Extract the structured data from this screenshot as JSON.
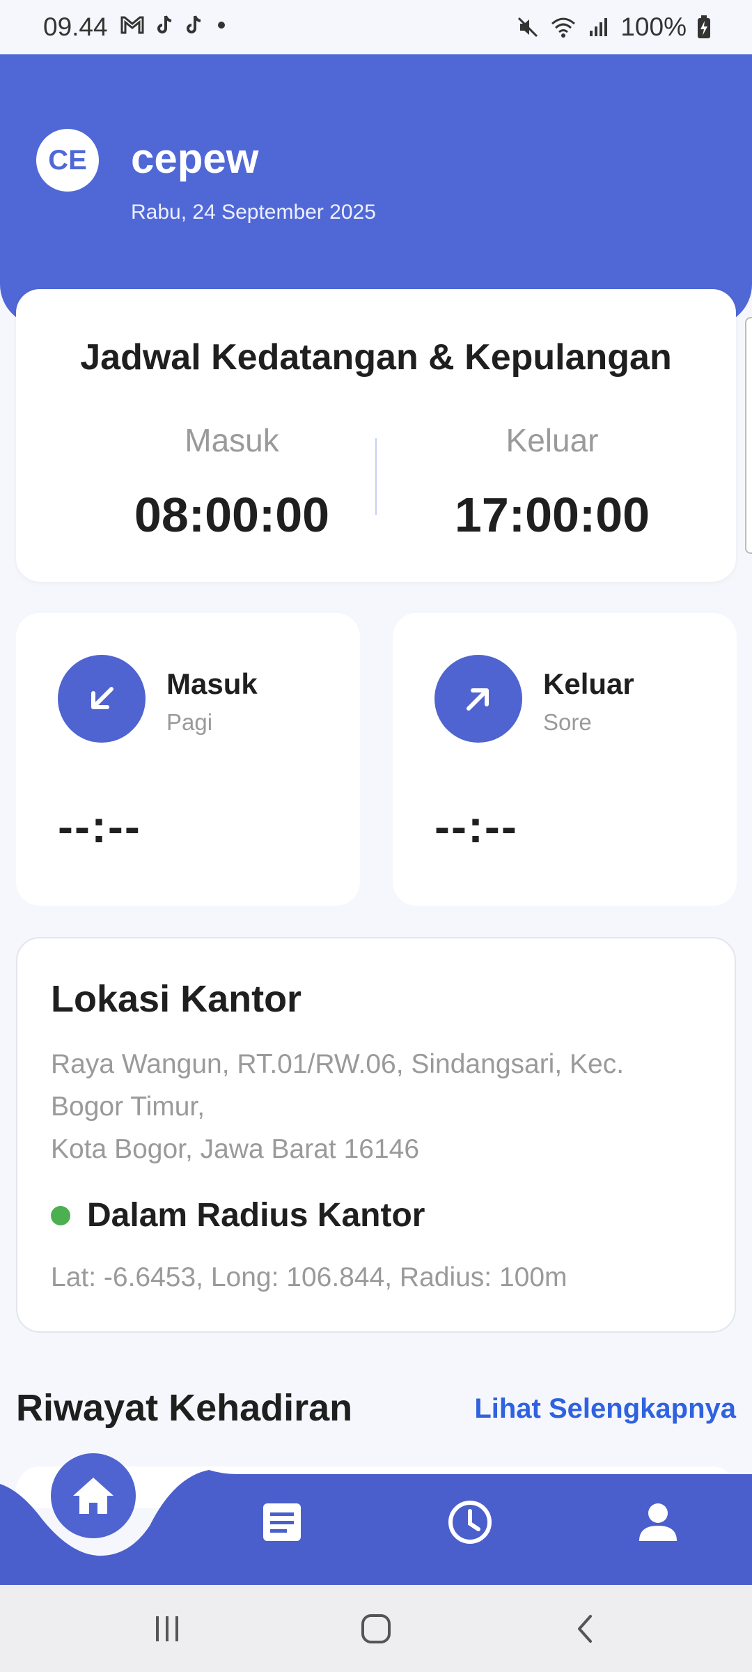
{
  "status_bar": {
    "time": "09.44",
    "battery": "100%",
    "icons": [
      "gmail-icon",
      "tiktok-icon",
      "tiktok-icon",
      "dot-icon",
      "mute-icon",
      "wifi-icon",
      "signal-icon",
      "battery-charging-icon"
    ]
  },
  "header": {
    "avatar_initials": "CE",
    "username": "cepew",
    "date": "Rabu, 24 September 2025"
  },
  "schedule": {
    "title": "Jadwal Kedatangan & Kepulangan",
    "in_label": "Masuk",
    "in_time": "08:00:00",
    "out_label": "Keluar",
    "out_time": "17:00:00"
  },
  "attendance": {
    "in": {
      "title": "Masuk",
      "subtitle": "Pagi",
      "time": "--:--",
      "icon": "arrow-down-left-icon"
    },
    "out": {
      "title": "Keluar",
      "subtitle": "Sore",
      "time": "--:--",
      "icon": "arrow-up-right-icon"
    }
  },
  "location": {
    "title": "Lokasi Kantor",
    "address_line1": "Raya Wangun, RT.01/RW.06, Sindangsari, Kec.",
    "address_line2": "Bogor Timur,",
    "address_line3": "Kota Bogor, Jawa Barat 16146",
    "status": "Dalam Radius Kantor",
    "status_color": "#4caf50",
    "coords": "Lat: -6.6453, Long: 106.844, Radius: 100m"
  },
  "history": {
    "title": "Riwayat Kehadiran",
    "see_more": "Lihat Selengkapnya"
  },
  "bottom_nav": {
    "items": [
      "home-icon",
      "document-icon",
      "clock-icon",
      "person-icon"
    ],
    "active": "home-icon"
  },
  "colors": {
    "primary": "#5068d6",
    "accent": "#4f64d0",
    "link": "#2f62e0"
  }
}
